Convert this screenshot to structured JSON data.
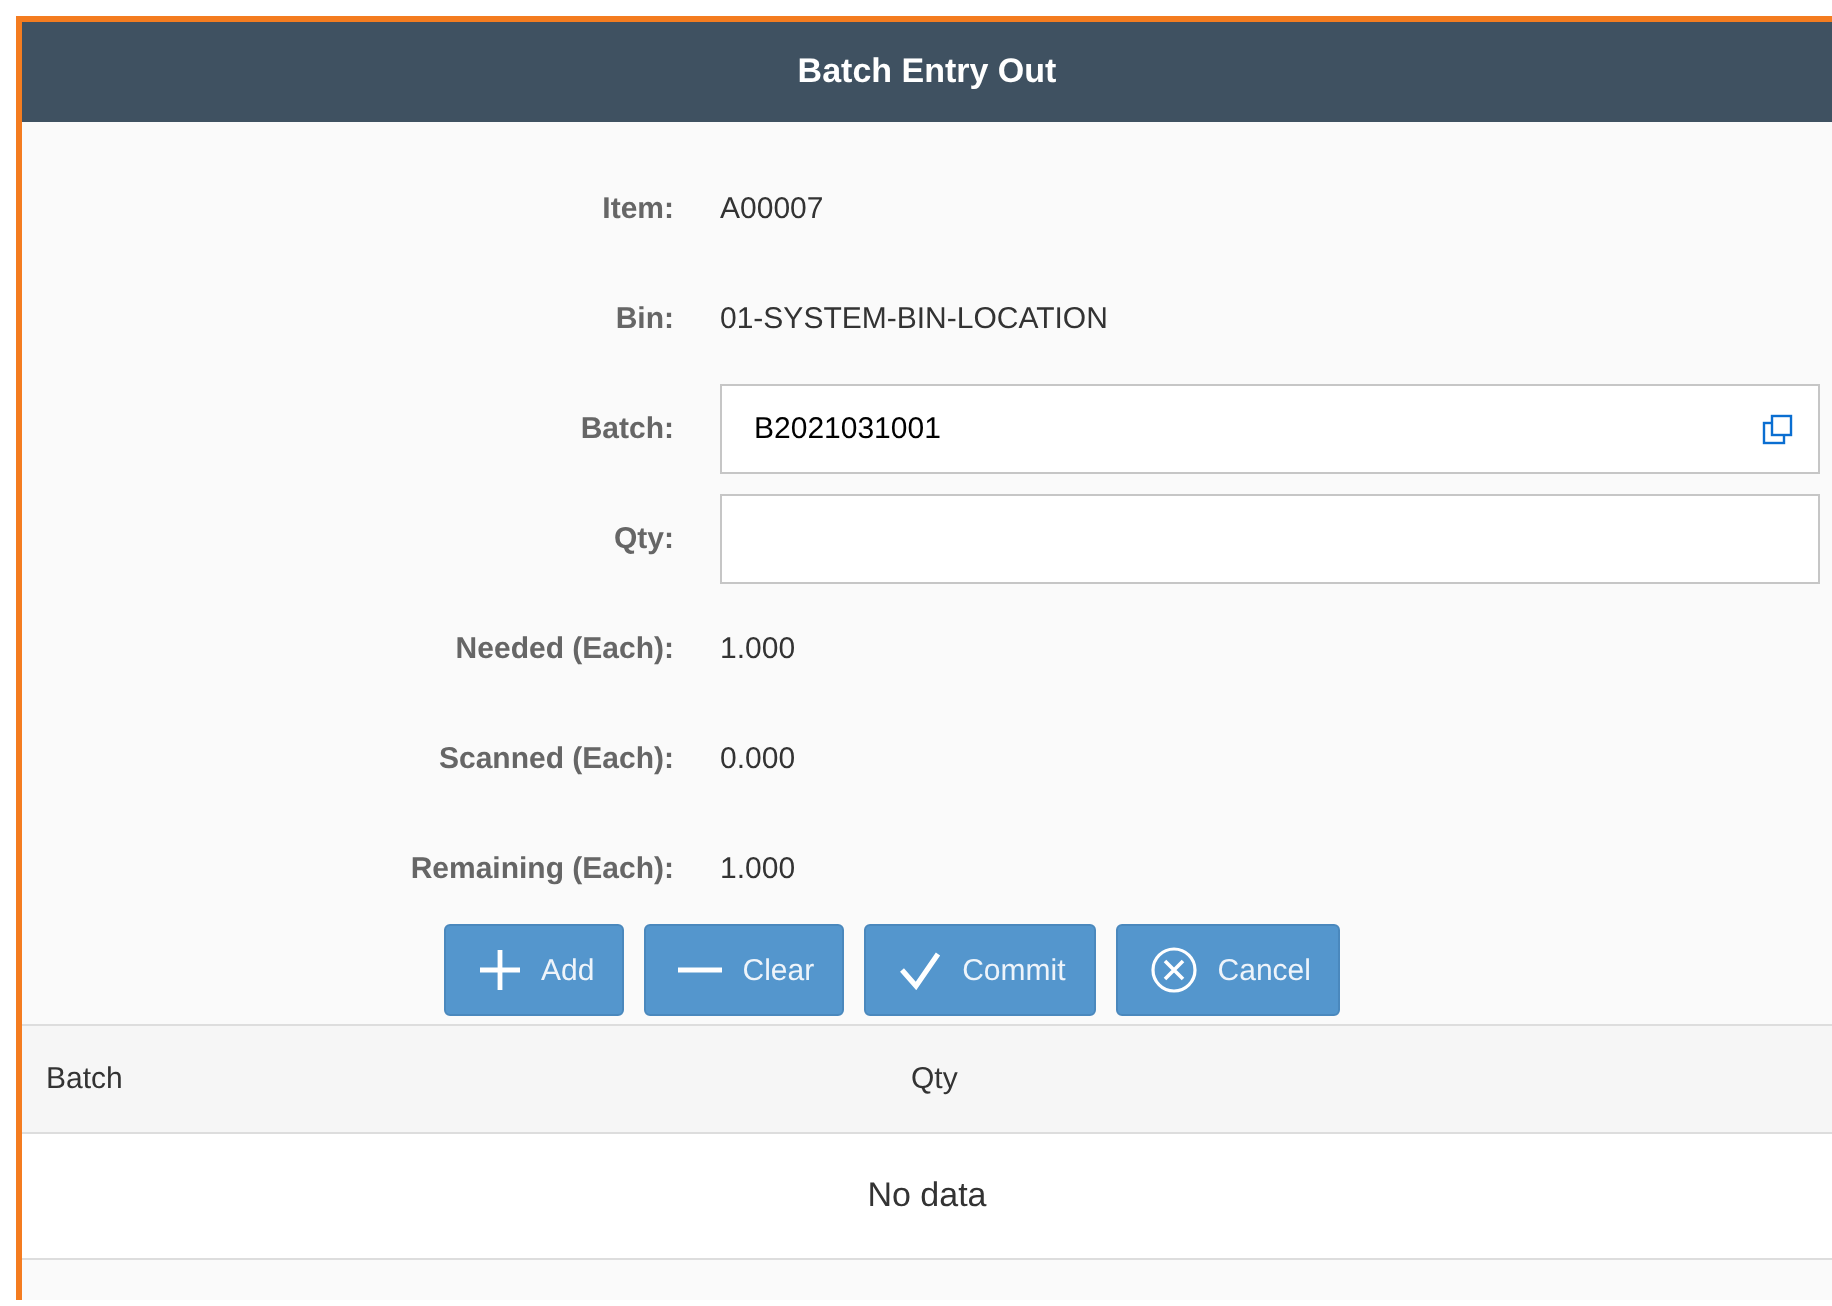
{
  "window": {
    "title": "Batch Entry Out"
  },
  "fields": [
    {
      "kind": "text",
      "label": "Item:",
      "value": "A00007"
    },
    {
      "kind": "text",
      "label": "Bin:",
      "value": "01-SYSTEM-BIN-LOCATION"
    },
    {
      "kind": "input",
      "label": "Batch:",
      "value": "B2021031001",
      "value_help": true
    },
    {
      "kind": "input",
      "label": "Qty:",
      "value_help": false
    },
    {
      "kind": "text",
      "label": "Needed (Each):",
      "value": "1.000"
    },
    {
      "kind": "text",
      "label": "Scanned (Each):",
      "value": "0.000"
    },
    {
      "kind": "text",
      "label": "Remaining (Each):",
      "value": "1.000"
    }
  ],
  "buttons": [
    {
      "kind": "add",
      "label": "Add"
    },
    {
      "kind": "clear",
      "label": "Clear"
    },
    {
      "kind": "commit",
      "label": "Commit"
    },
    {
      "kind": "cancel",
      "label": "Cancel"
    }
  ],
  "table": {
    "columns": [
      "Batch",
      "Qty"
    ],
    "empty_text": "No data"
  }
}
